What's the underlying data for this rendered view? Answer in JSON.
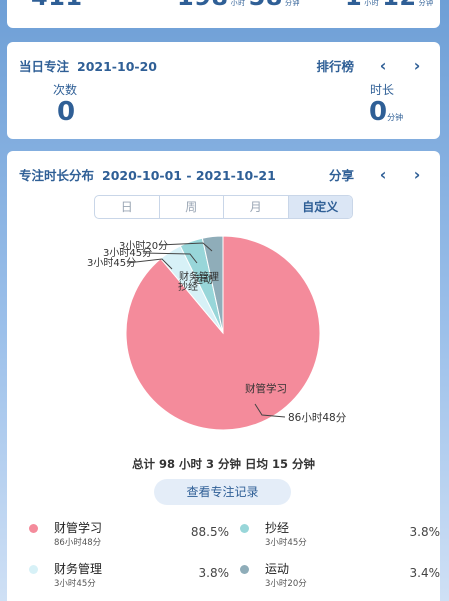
{
  "top_stats": {
    "count": "411",
    "hours": "198",
    "hours_unit": "小时",
    "minutes": "58",
    "minutes_unit": "分钟",
    "avg_hours": "1",
    "avg_hours_unit": "小时",
    "avg_minutes": "12",
    "avg_minutes_unit": "分钟"
  },
  "today": {
    "title": "当日专注",
    "date": "2021-10-20",
    "ranking_label": "排行榜",
    "prev_icon": "chevron-left-icon",
    "next_icon": "chevron-right-icon",
    "count_label": "次数",
    "count_value": "0",
    "duration_label": "时长",
    "duration_value": "0",
    "duration_unit": "分钟"
  },
  "distribution": {
    "title": "专注时长分布",
    "date_range": "2020-10-01 - 2021-10-21",
    "share_label": "分享",
    "tabs": [
      "日",
      "周",
      "月",
      "自定义"
    ],
    "active_tab": "自定义",
    "summary": "总计 98 小时 3 分钟 日均 15 分钟",
    "record_button": "查看专注记录"
  },
  "chart_data": {
    "type": "pie",
    "unit": "minutes",
    "slices": [
      {
        "name": "财管学习",
        "time": "86小时48分",
        "minutes": 5208,
        "percent": "88.5%",
        "color": "#f48b9b"
      },
      {
        "name": "抄经",
        "time": "3小时45分",
        "minutes": 225,
        "percent": "3.8%",
        "color": "#98d6d9"
      },
      {
        "name": "财务管理",
        "time": "3小时45分",
        "minutes": 225,
        "percent": "3.8%",
        "color": "#d7f1f7"
      },
      {
        "name": "运动",
        "time": "3小时20分",
        "minutes": 200,
        "percent": "3.4%",
        "color": "#8fadb9"
      }
    ],
    "legend": "bottom"
  }
}
